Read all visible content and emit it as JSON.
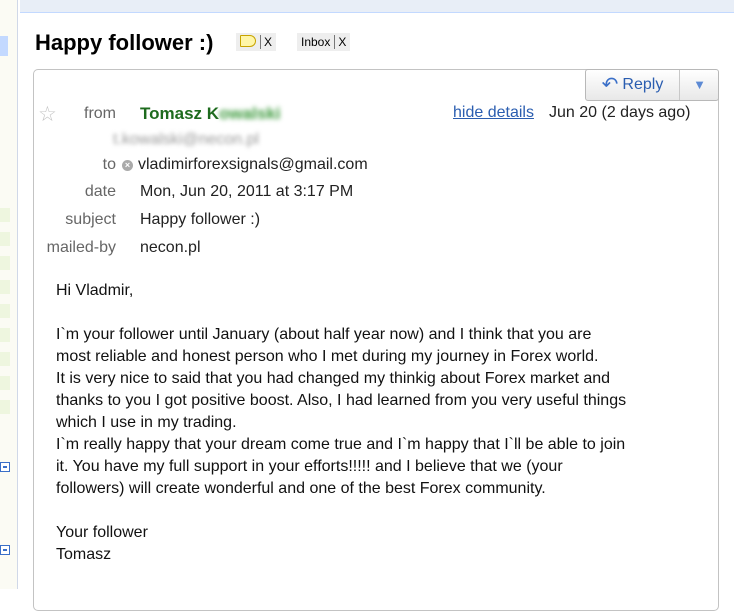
{
  "subject": {
    "title": "Happy follower :)",
    "labels": [
      {
        "icon": "tag-icon",
        "close": "X"
      },
      {
        "text": "Inbox",
        "close": "X"
      }
    ]
  },
  "reply_button": {
    "label": "Reply",
    "dropdown": "▼"
  },
  "header": {
    "from_label": "from",
    "sender_name_visible": "Tomasz K",
    "sender_name_blurred": "owalski",
    "sender_email_blurred": "t.kowalski@necon.pl",
    "to_label": "to",
    "to_value": "vladimirforexsignals@gmail.com",
    "date_label": "date",
    "date_value": "Mon, Jun 20, 2011 at 3:17 PM",
    "subject_label": "subject",
    "subject_value": "Happy follower :)",
    "mailedby_label": "mailed-by",
    "mailedby_value": "necon.pl",
    "hide_details": "hide details",
    "date_short": "Jun 20 (2 days ago)"
  },
  "body": {
    "greeting": "Hi Vladmir,",
    "paragraph_lines": [
      "I`m your follower until January (about half year now) and I think that you are",
      "most reliable and honest person who I met during my journey in Forex world.",
      "It is very nice to said that you had changed my thinkig about Forex market and",
      "thanks to you I got positive boost. Also, I had learned from you very useful things",
      "which I use in my trading.",
      "I`m really happy that your dream come true and I`m happy that I`ll be able to join",
      "it. You have my full support in your efforts!!!!! and I believe that we (your",
      "followers) will create wonderful and one of the best Forex community."
    ],
    "signoff_1": "Your follower",
    "signoff_2": "Tomasz"
  }
}
